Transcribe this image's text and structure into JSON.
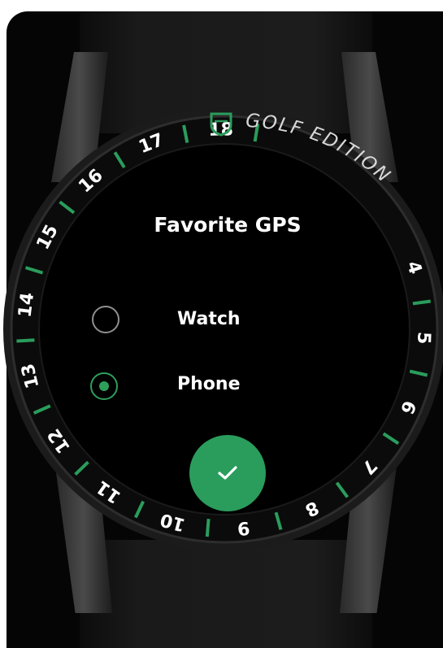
{
  "screen": {
    "title": "Favorite GPS",
    "options": [
      {
        "label": "Watch",
        "selected": false
      },
      {
        "label": "Phone",
        "selected": true
      }
    ],
    "confirm_icon": "checkmark-icon"
  },
  "bezel": {
    "numbers": [
      "4",
      "5",
      "6",
      "7",
      "8",
      "9",
      "10",
      "11",
      "12",
      "13",
      "14",
      "15",
      "16",
      "17",
      "18"
    ],
    "edition_text": "GOLF EDITION",
    "logo_icon": "tag-heuer-shield-icon"
  },
  "colors": {
    "accent": "#2a9d5c",
    "background": "#050505",
    "text": "#ffffff",
    "radio_off": "#8f8f8f"
  }
}
